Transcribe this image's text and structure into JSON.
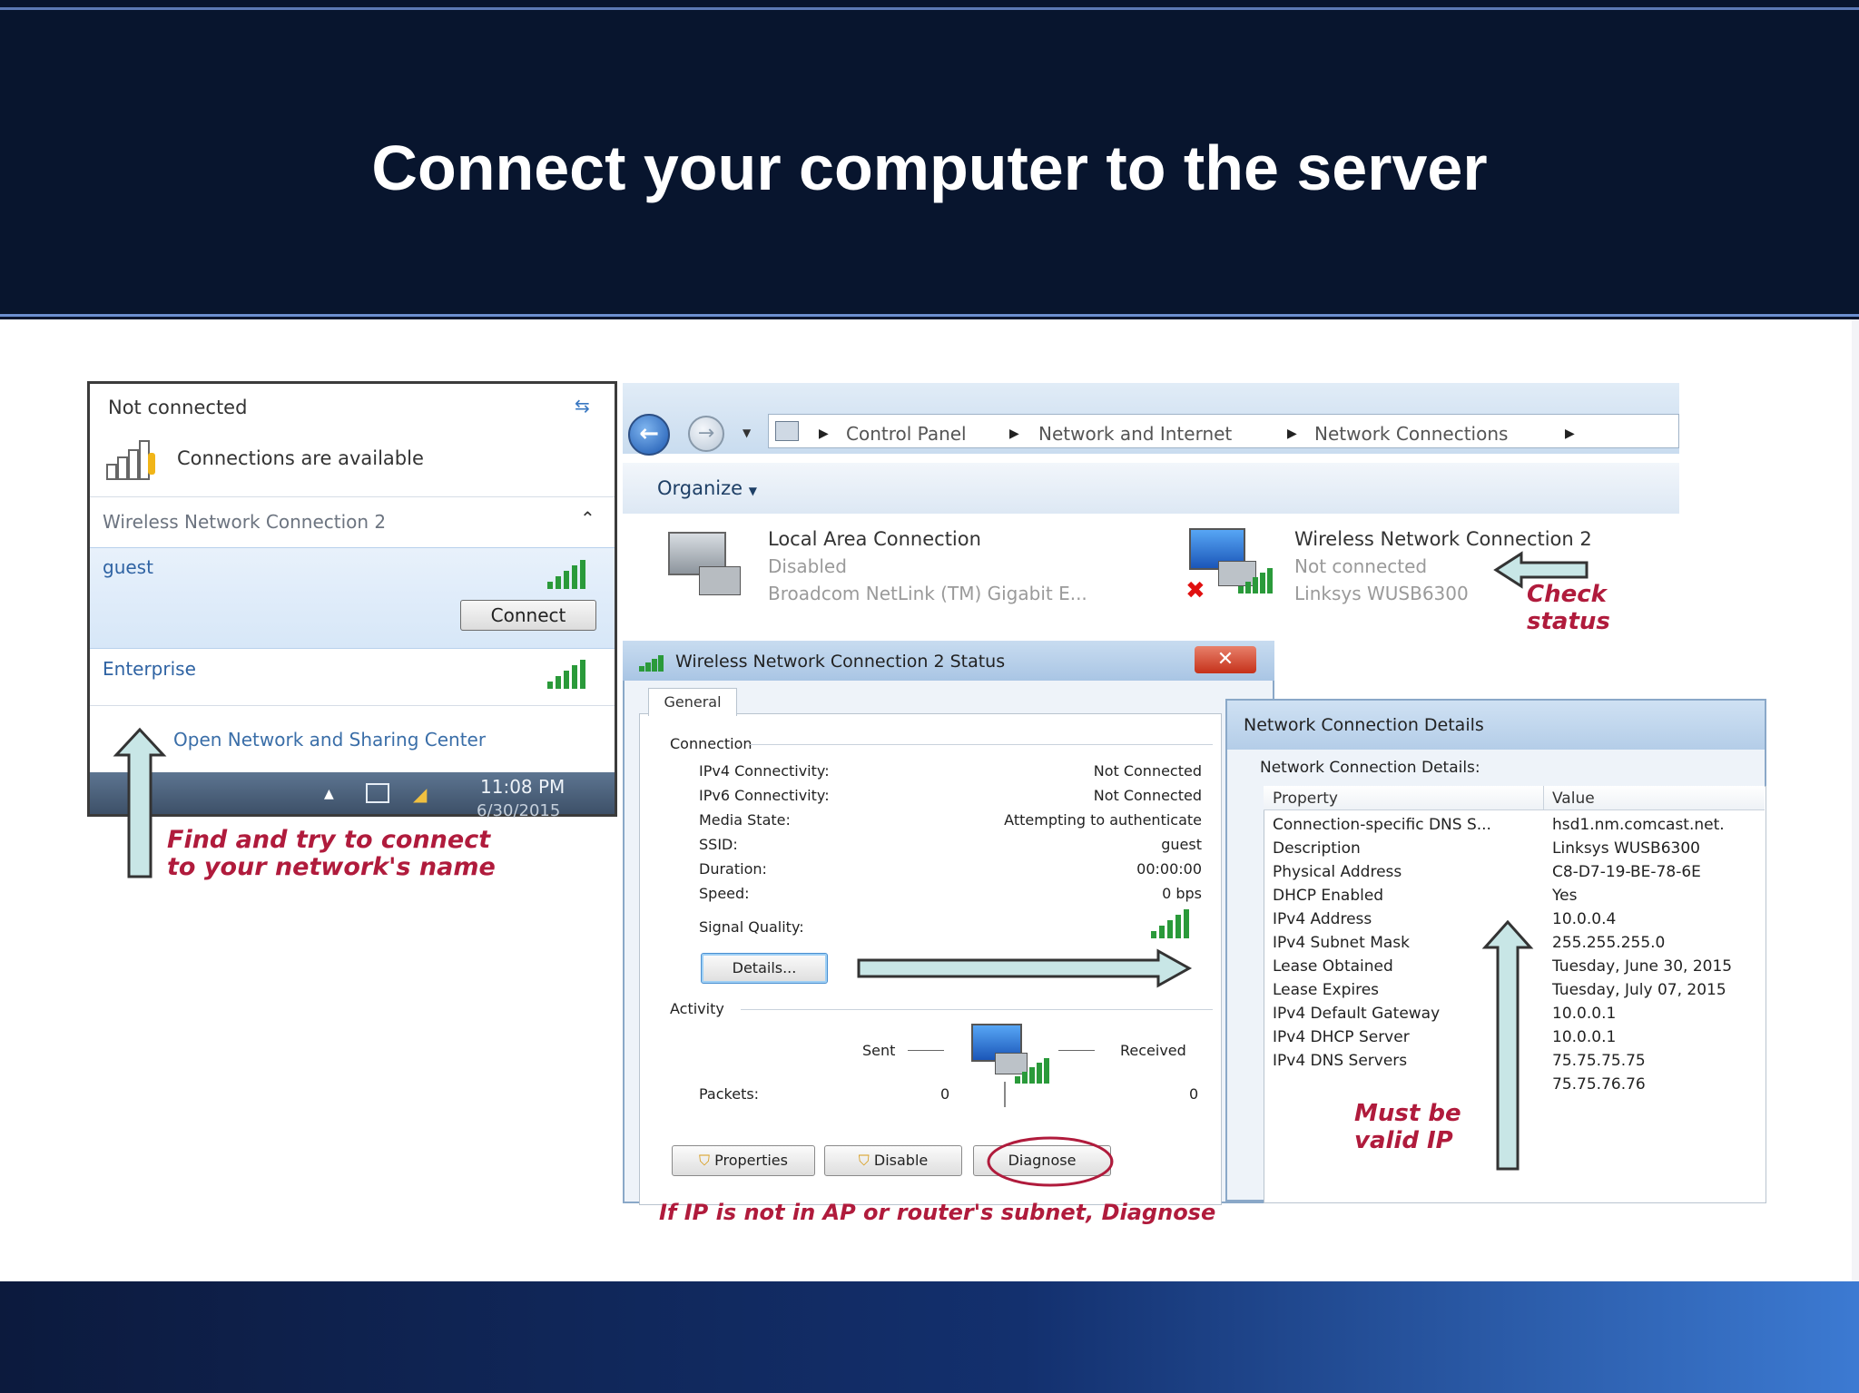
{
  "slide": {
    "title": "Connect your computer to the server"
  },
  "flyout": {
    "status": "Not connected",
    "available": "Connections are available",
    "section": "Wireless Network Connection 2",
    "networks": [
      {
        "name": "guest"
      },
      {
        "name": "Enterprise"
      }
    ],
    "connect_label": "Connect",
    "open_center_link": "Open Network and Sharing Center",
    "clock_time": "11:08 PM",
    "clock_date": "6/30/2015"
  },
  "explorer": {
    "breadcrumb": [
      "Control Panel",
      "Network and Internet",
      "Network Connections"
    ],
    "organize_label": "Organize",
    "connections": [
      {
        "name": "Local Area Connection",
        "status": "Disabled",
        "device": "Broadcom NetLink (TM) Gigabit E..."
      },
      {
        "name": "Wireless Network Connection 2",
        "status": "Not connected",
        "device": "Linksys WUSB6300"
      }
    ]
  },
  "status_dialog": {
    "title": "Wireless Network Connection 2 Status",
    "tab": "General",
    "connection_heading": "Connection",
    "rows": [
      {
        "label": "IPv4 Connectivity:",
        "value": "Not Connected"
      },
      {
        "label": "IPv6 Connectivity:",
        "value": "Not Connected"
      },
      {
        "label": "Media State:",
        "value": "Attempting to authenticate"
      },
      {
        "label": "SSID:",
        "value": "guest"
      },
      {
        "label": "Duration:",
        "value": "00:00:00"
      },
      {
        "label": "Speed:",
        "value": "0 bps"
      }
    ],
    "signal_label": "Signal Quality:",
    "details_button": "Details...",
    "activity_heading": "Activity",
    "sent_label": "Sent",
    "received_label": "Received",
    "packets_label": "Packets:",
    "packets_sent": "0",
    "packets_received": "0",
    "buttons": [
      "Properties",
      "Disable",
      "Diagnose"
    ]
  },
  "details_dialog": {
    "title": "Network Connection Details",
    "subtitle": "Network Connection Details:",
    "col_property": "Property",
    "col_value": "Value",
    "rows": [
      {
        "property": "Connection-specific DNS S...",
        "value": "hsd1.nm.comcast.net."
      },
      {
        "property": "Description",
        "value": "Linksys WUSB6300"
      },
      {
        "property": "Physical Address",
        "value": "C8-D7-19-BE-78-6E"
      },
      {
        "property": "DHCP Enabled",
        "value": "Yes"
      },
      {
        "property": "IPv4 Address",
        "value": "10.0.0.4"
      },
      {
        "property": "IPv4 Subnet Mask",
        "value": "255.255.255.0"
      },
      {
        "property": "Lease Obtained",
        "value": "Tuesday, June 30, 2015"
      },
      {
        "property": "Lease Expires",
        "value": "Tuesday, July 07, 2015"
      },
      {
        "property": "IPv4 Default Gateway",
        "value": "10.0.0.1"
      },
      {
        "property": "IPv4 DHCP Server",
        "value": "10.0.0.1"
      },
      {
        "property": "IPv4 DNS Servers",
        "value": "75.75.75.75"
      },
      {
        "property": "",
        "value": "75.75.76.76"
      }
    ]
  },
  "annotations": {
    "find_line1": "Find and try to connect",
    "find_line2": "to your network's name",
    "check_line1": "Check",
    "check_line2": "status",
    "valid_line1": "Must be",
    "valid_line2": "valid IP",
    "diagnose_note": "If IP is not in AP or router's subnet, Diagnose"
  }
}
